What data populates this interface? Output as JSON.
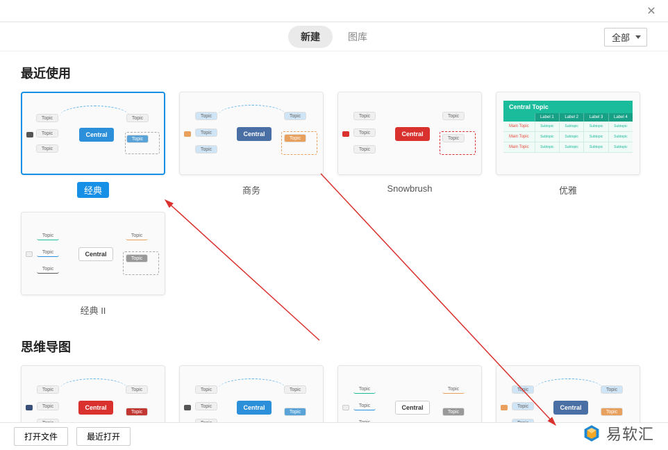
{
  "topbar": {
    "close_glyph": "✕"
  },
  "header": {
    "tabs": [
      {
        "label": "新建",
        "active": true
      },
      {
        "label": "图库",
        "active": false
      }
    ],
    "filter_selected": "全部"
  },
  "sections": [
    {
      "title": "最近使用",
      "items": [
        {
          "name": "经典",
          "theme": "blue",
          "selected": true
        },
        {
          "name": "商务",
          "theme": "steel",
          "selected": false
        },
        {
          "name": "Snowbrush",
          "theme": "red",
          "selected": false
        },
        {
          "name": "优雅",
          "theme": "table",
          "selected": false
        },
        {
          "name": "经典 II",
          "theme": "light",
          "selected": false
        }
      ]
    },
    {
      "title": "思维导图",
      "items": [
        {
          "name": "",
          "theme": "red",
          "selected": false
        },
        {
          "name": "",
          "theme": "blue",
          "selected": false
        },
        {
          "name": "",
          "theme": "light",
          "selected": false
        },
        {
          "name": "",
          "theme": "steel",
          "selected": false
        }
      ]
    }
  ],
  "thumb_text": {
    "central": "Central",
    "central_topic": "Central Topic",
    "topic": "Topic",
    "main_topic": "Main Topic",
    "label": "Label"
  },
  "table_thumb": {
    "header": "Central Topic",
    "labels": [
      "",
      "Label 1",
      "Label 2",
      "Label 3",
      "Label 4"
    ],
    "rows": [
      [
        "Main Topic",
        "Subtopic",
        "Subtopic",
        "Subtopic",
        "Subtopic"
      ],
      [
        "Main Topic",
        "Subtopic",
        "Subtopic",
        "Subtopic",
        "Subtopic"
      ],
      [
        "Main Topic",
        "Subtopic",
        "Subtopic",
        "Subtopic",
        "Subtopic"
      ]
    ]
  },
  "footer": {
    "open_file": "打开文件",
    "recent_open": "最近打开"
  },
  "watermark": {
    "text": "易软汇"
  }
}
